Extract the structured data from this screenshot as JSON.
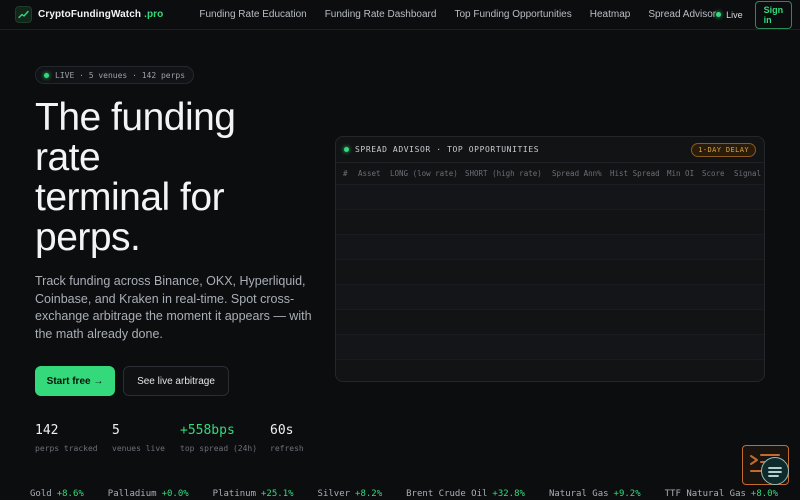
{
  "brand": {
    "name": "CryptoFundingWatch",
    "suffix": ".pro",
    "accent": "#34d97b"
  },
  "nav": {
    "links": [
      "Funding Rate Education",
      "Funding Rate Dashboard",
      "Top Funding Opportunities",
      "Heatmap",
      "Spread Advisor"
    ],
    "live_label": "Live",
    "signin_label": "Sign in"
  },
  "hero": {
    "pill": "LIVE · 5 venues · 142 perps",
    "headline_lines": [
      "The funding",
      "rate",
      "terminal for",
      "perps."
    ],
    "subtext": "Track funding across Binance, OKX, Hyperliquid, Coinbase, and Kraken in real-time. Spot cross-exchange arbitrage the moment it appears — with the math already done.",
    "cta_primary": "Start free →",
    "cta_secondary": "See live arbitrage"
  },
  "stats": [
    {
      "value": "142",
      "label": "perps tracked"
    },
    {
      "value": "5",
      "label": "venues live"
    },
    {
      "value": "+558bps",
      "label": "top spread (24h)"
    },
    {
      "value": "60s",
      "label": "refresh"
    }
  ],
  "panel": {
    "title": "SPREAD ADVISOR · TOP OPPORTUNITIES",
    "badge": "1-DAY DELAY",
    "columns": [
      "#",
      "Asset",
      "LONG (low rate)",
      "SHORT (high rate)",
      "Spread Ann%",
      "Hist Spread",
      "Min OI",
      "Score",
      "Signal"
    ]
  },
  "ticker": [
    {
      "name": "Gold",
      "change": "+8.6%"
    },
    {
      "name": "Palladium",
      "change": "+0.0%"
    },
    {
      "name": "Platinum",
      "change": "+25.1%"
    },
    {
      "name": "Silver",
      "change": "+8.2%"
    },
    {
      "name": "Brent Crude Oil",
      "change": "+32.8%"
    },
    {
      "name": "Natural Gas",
      "change": "+9.2%"
    },
    {
      "name": "TTF Natural Gas",
      "change": "+8.0%"
    }
  ]
}
